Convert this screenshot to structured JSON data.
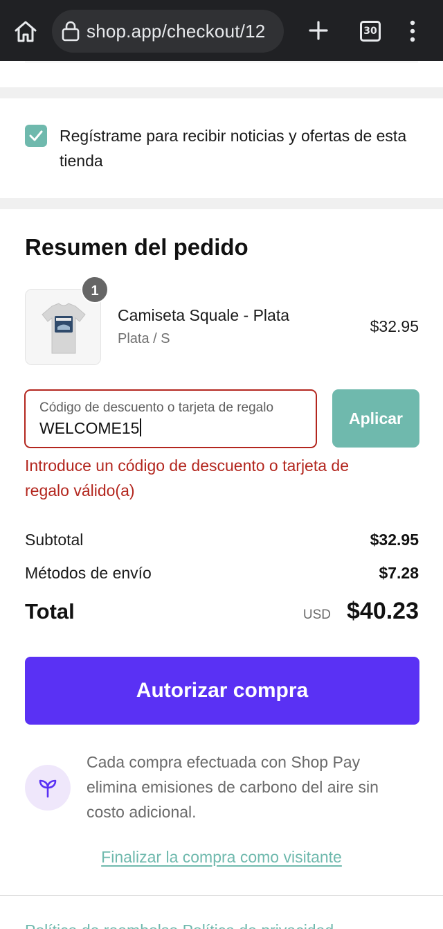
{
  "browser": {
    "url": "shop.app/checkout/12",
    "tab_count": "30"
  },
  "newsletter": {
    "checked": true,
    "label": "Regístrame para recibir noticias y ofertas de esta tienda"
  },
  "summary": {
    "title": "Resumen del pedido",
    "item": {
      "quantity": "1",
      "name": "Camiseta Squale - Plata",
      "variant": "Plata / S",
      "price": "$32.95"
    },
    "discount": {
      "label": "Código de descuento o tarjeta de regalo",
      "value": "WELCOME15",
      "apply_label": "Aplicar",
      "error": "Introduce un código de descuento o tarjeta de regalo válido(a)"
    },
    "subtotal_label": "Subtotal",
    "subtotal_value": "$32.95",
    "shipping_label": "Métodos de envío",
    "shipping_value": "$7.28",
    "total_label": "Total",
    "total_currency": "USD",
    "total_value": "$40.23"
  },
  "actions": {
    "authorize_label": "Autorizar compra",
    "carbon_text": "Cada compra efectuada con Shop Pay elimina emisiones de carbono del aire sin costo adicional.",
    "guest_link": "Finalizar la compra como visitante"
  },
  "footer": {
    "policy_links": "Política de reembolso   Política de privacidad"
  },
  "colors": {
    "accent_teal": "#6fb9ad",
    "shop_pay_purple": "#5a31f4",
    "error_red": "#b3261e",
    "chrome_dark": "#202124"
  }
}
